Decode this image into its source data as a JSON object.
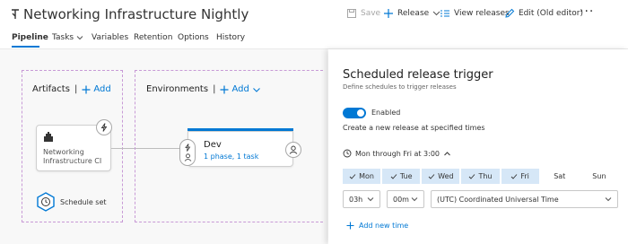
{
  "header": {
    "title": "Networking Infrastructure Nightly",
    "save_label": "Save",
    "release_label": "Release",
    "view_releases_label": "View releases",
    "edit_label": "Edit (Old editor)",
    "more_label": "···"
  },
  "tabs": [
    {
      "label": "Pipeline",
      "active": true
    },
    {
      "label": "Tasks",
      "active": false
    },
    {
      "label": "Variables",
      "active": false
    },
    {
      "label": "Retention",
      "active": false
    },
    {
      "label": "Options",
      "active": false
    },
    {
      "label": "History",
      "active": false
    }
  ],
  "canvas": {
    "artifacts_label": "Artifacts",
    "artifacts_add": "Add",
    "environments_label": "Environments",
    "environments_add": "Add",
    "separator": "|",
    "artifact_name_line1": "Networking",
    "artifact_name_line2": "Infrastructure CI",
    "schedule_label": "Schedule set",
    "stage_name": "Dev",
    "stage_detail": "1 phase, 1 task"
  },
  "panel": {
    "title": "Scheduled release trigger",
    "subtitle": "Define schedules to trigger releases",
    "toggle_label": "Enabled",
    "toggle_on": true,
    "create_text": "Create a new release at specified times",
    "schedule_summary": "Mon through Fri at 3:00",
    "days": [
      {
        "label": "Mon",
        "selected": true
      },
      {
        "label": "Tue",
        "selected": true
      },
      {
        "label": "Wed",
        "selected": true
      },
      {
        "label": "Thu",
        "selected": true
      },
      {
        "label": "Fri",
        "selected": true
      },
      {
        "label": "Sat",
        "selected": false
      },
      {
        "label": "Sun",
        "selected": false
      }
    ],
    "hour_value": "03h",
    "minute_value": "00m",
    "timezone_value": "(UTC) Coordinated Universal Time",
    "add_time_label": "Add new time"
  },
  "colors": {
    "accent": "#0078d4",
    "selected_day_bg": "#d6e7f7",
    "dashed_border": "#c89ad6"
  }
}
